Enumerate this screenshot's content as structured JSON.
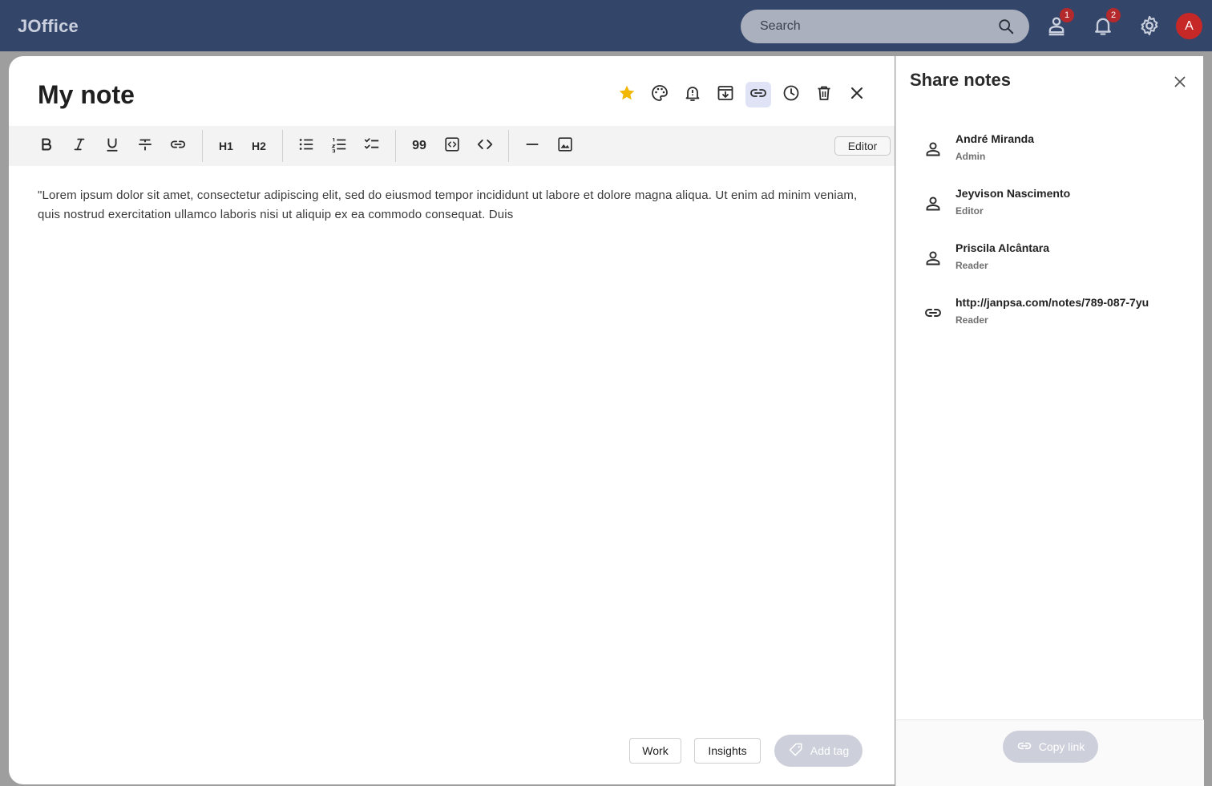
{
  "app": {
    "brand": "JOffice"
  },
  "topbar": {
    "search_placeholder": "Search",
    "user_badge": "1",
    "notification_badge": "2",
    "avatar_initial": "A"
  },
  "note": {
    "title": "My note",
    "body": "\"Lorem ipsum dolor sit amet, consectetur adipiscing elit, sed do eiusmod tempor incididunt ut labore et dolore magna aliqua. Ut enim ad minim veniam, quis nostrud exercitation ullamco laboris nisi ut aliquip ex ea commodo consequat. Duis",
    "mode_label": "Editor",
    "heading1_label": "H1",
    "heading2_label": "H2",
    "quote_label": "99",
    "tags": [
      "Work",
      "Insights"
    ],
    "add_tag_label": "Add tag",
    "star_color": "#f2b705"
  },
  "share": {
    "title": "Share notes",
    "members": [
      {
        "name": "André Miranda",
        "role": "Admin",
        "icon": "person-icon"
      },
      {
        "name": "Jeyvison Nascimento",
        "role": "Editor",
        "icon": "person-icon"
      },
      {
        "name": "Priscila Alcântara",
        "role": "Reader",
        "icon": "person-icon"
      },
      {
        "name": "http://janpsa.com/notes/789-087-7yu",
        "role": "Reader",
        "icon": "link-icon"
      }
    ],
    "copy_link_label": "Copy link"
  }
}
